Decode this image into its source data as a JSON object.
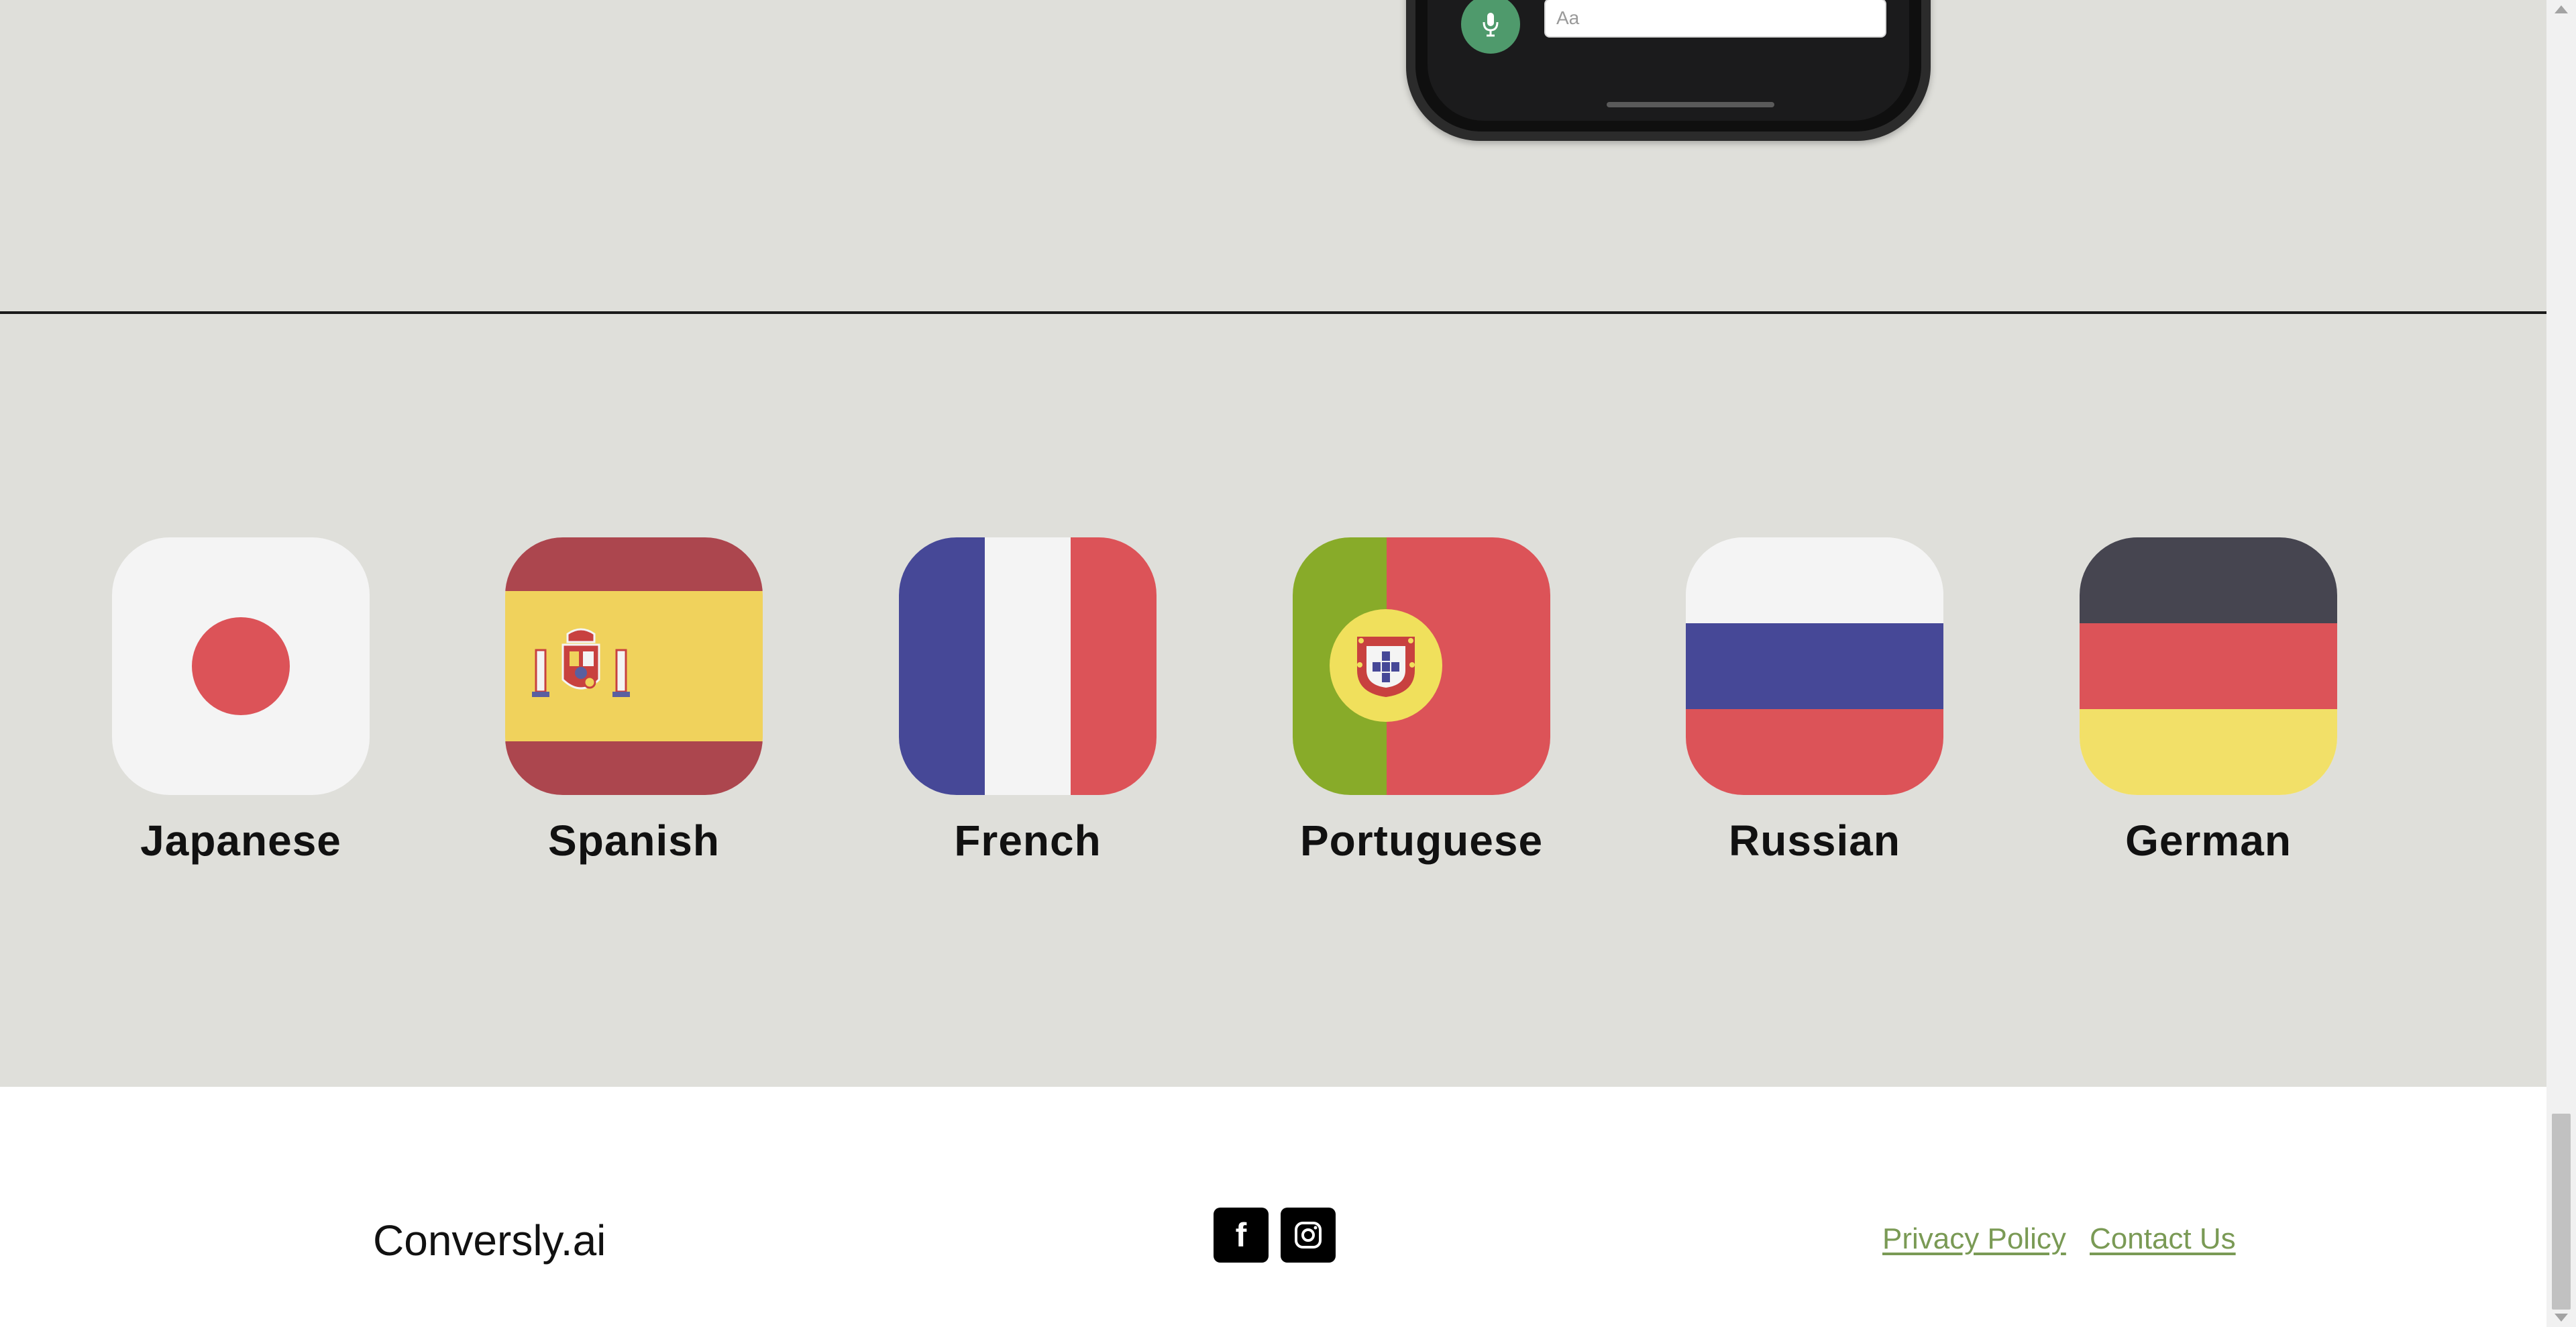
{
  "phone": {
    "input_placeholder": "Aa",
    "mic_icon": "microphone-icon"
  },
  "languages": [
    {
      "label": "Japanese",
      "flag_icon": "japan-flag-icon"
    },
    {
      "label": "Spanish",
      "flag_icon": "spain-flag-icon"
    },
    {
      "label": "French",
      "flag_icon": "france-flag-icon"
    },
    {
      "label": "Portuguese",
      "flag_icon": "portugal-flag-icon"
    },
    {
      "label": "Russian",
      "flag_icon": "russia-flag-icon"
    },
    {
      "label": "German",
      "flag_icon": "germany-flag-icon"
    }
  ],
  "footer": {
    "brand": "Conversly.ai",
    "social": [
      {
        "icon": "facebook-icon",
        "glyph": "f"
      },
      {
        "icon": "instagram-icon"
      }
    ],
    "links": [
      {
        "label": "Privacy Policy"
      },
      {
        "label": "Contact Us"
      }
    ]
  },
  "colors": {
    "background": "#dfdfda",
    "footer_bg": "#ffffff",
    "link": "#7a9a55",
    "mic_button": "#4f9a6c"
  }
}
